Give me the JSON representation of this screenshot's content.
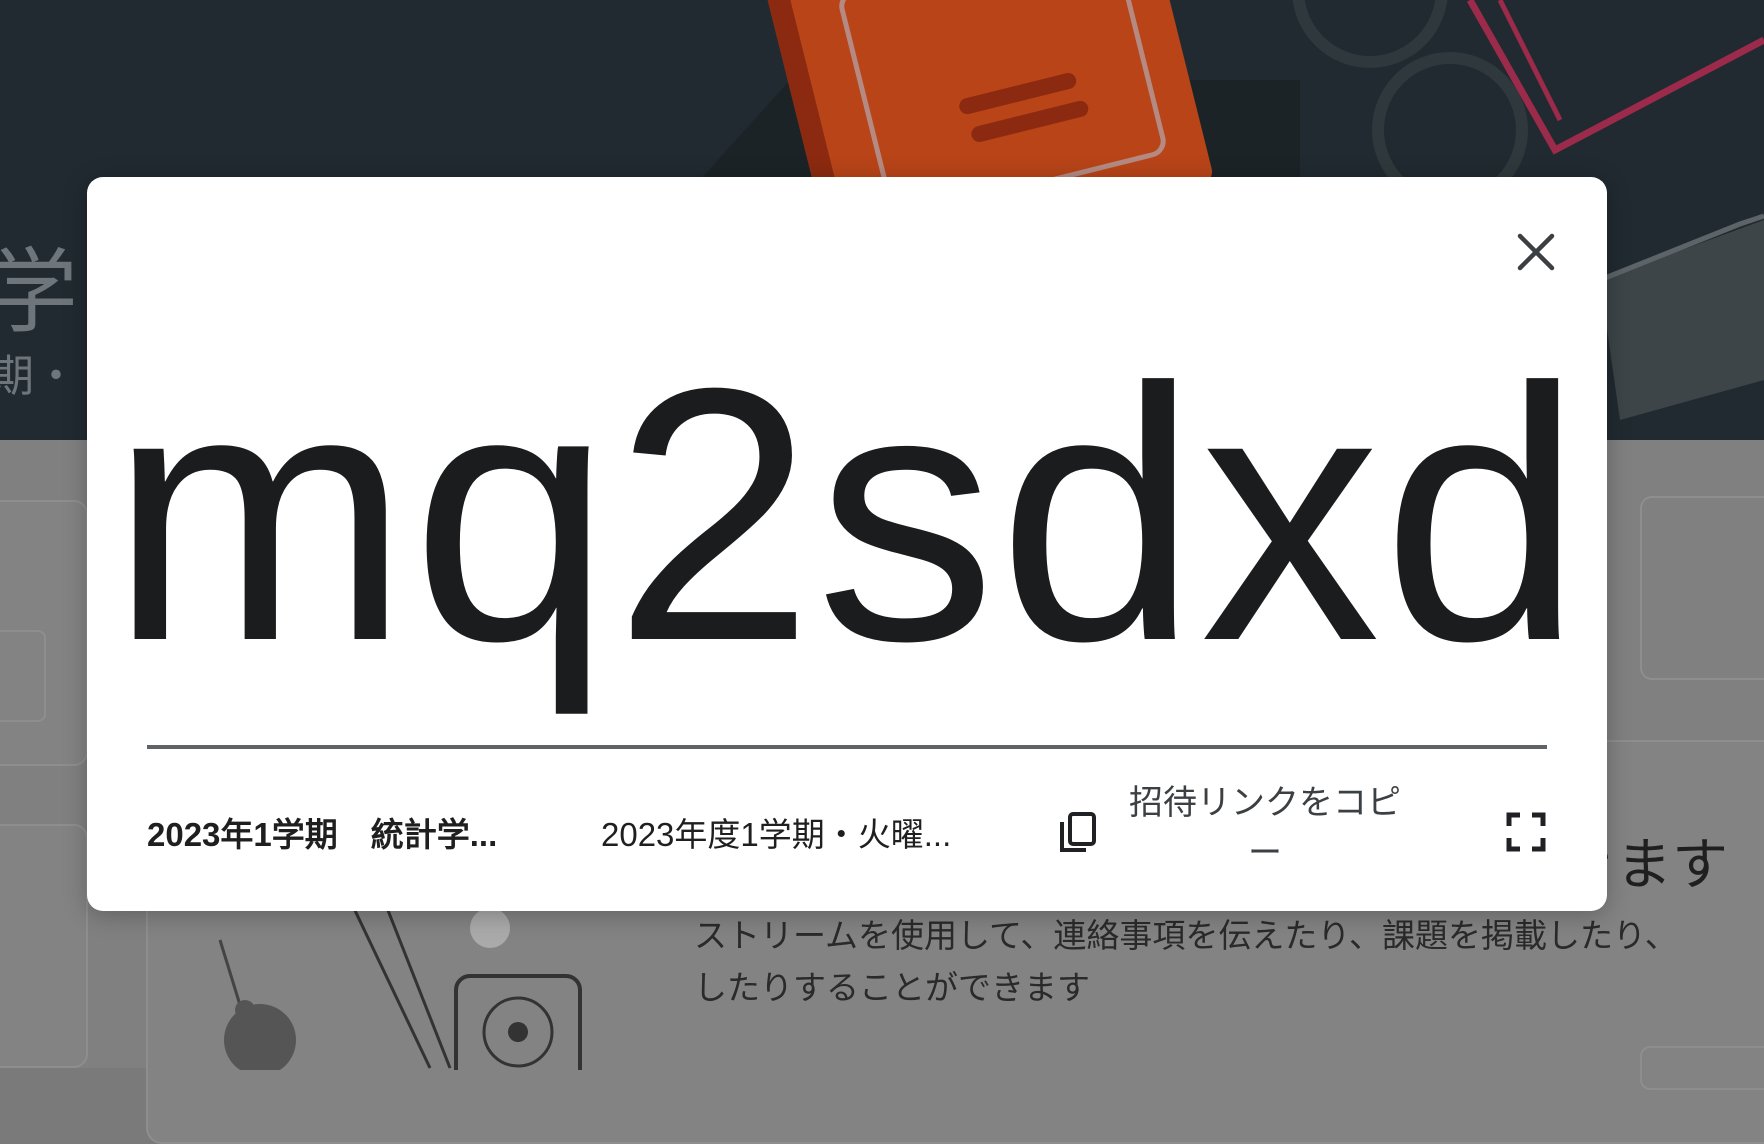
{
  "background": {
    "banner_title": "学",
    "banner_subtitle": "期・",
    "card_heading": "きます",
    "card_description": "ストリームを使用して、連絡事項を伝えたり、課題を掲載したり、\nしたりすることができます"
  },
  "modal": {
    "class_code": "mq2sdxd",
    "class_name": "2023年1学期　統計学...",
    "class_section": "2023年度1学期・火曜...",
    "copy_invite_link_label": "招待リンクをコピー",
    "close_icon": "close-icon",
    "copy_icon": "copy-icon",
    "fullscreen_icon": "fullscreen-icon"
  },
  "colors": {
    "banner_bg": "#202a30",
    "overlay_bg": "#808080",
    "modal_bg": "#ffffff",
    "code_text": "#1b1c1e",
    "book_orange": "#c44a1c",
    "glasses_pink": "#9c2a4a"
  }
}
